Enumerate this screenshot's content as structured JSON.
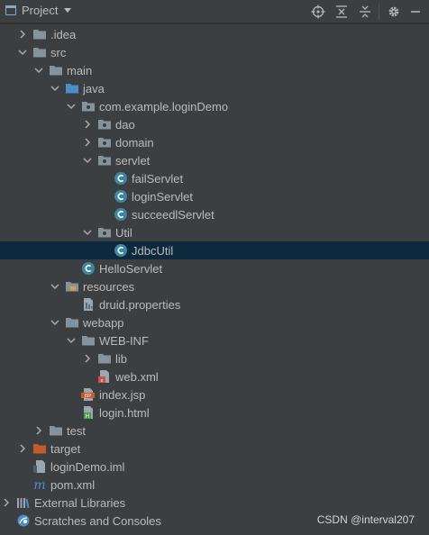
{
  "header": {
    "title": "Project",
    "icons": [
      "target-icon",
      "collapse-all-icon",
      "expand-all-icon",
      "gear-icon",
      "minimize-icon"
    ]
  },
  "colors": {
    "background": "#3c3f41",
    "selection": "#0d293e",
    "folder": "#87939a",
    "source_folder": "#4f8cc9",
    "class_icon": "#3e86a0",
    "target_folder": "#c55a2b"
  },
  "tree": [
    {
      "label": ".idea",
      "icon": "folder-icon",
      "arrow": "collapsed"
    },
    {
      "label": "src",
      "icon": "folder-icon",
      "arrow": "expanded"
    },
    {
      "label": "main",
      "icon": "folder-icon",
      "arrow": "expanded"
    },
    {
      "label": "java",
      "icon": "source-folder-icon",
      "arrow": "expanded"
    },
    {
      "label": "com.example.loginDemo",
      "icon": "package-icon",
      "arrow": "expanded"
    },
    {
      "label": "dao",
      "icon": "package-icon",
      "arrow": "collapsed"
    },
    {
      "label": "domain",
      "icon": "package-icon",
      "arrow": "collapsed"
    },
    {
      "label": "servlet",
      "icon": "package-icon",
      "arrow": "expanded"
    },
    {
      "label": "failServlet",
      "icon": "class-icon",
      "arrow": "none"
    },
    {
      "label": "loginServlet",
      "icon": "class-icon",
      "arrow": "none"
    },
    {
      "label": "succeedlServlet",
      "icon": "class-icon",
      "arrow": "none"
    },
    {
      "label": "Util",
      "icon": "package-icon",
      "arrow": "expanded"
    },
    {
      "label": "JdbcUtil",
      "icon": "class-icon",
      "arrow": "none",
      "selected": true
    },
    {
      "label": "HelloServlet",
      "icon": "class-icon",
      "arrow": "none"
    },
    {
      "label": "resources",
      "icon": "resources-folder-icon",
      "arrow": "expanded"
    },
    {
      "label": "druid.properties",
      "icon": "properties-file-icon",
      "arrow": "none"
    },
    {
      "label": "webapp",
      "icon": "web-folder-icon",
      "arrow": "expanded"
    },
    {
      "label": "WEB-INF",
      "icon": "folder-icon",
      "arrow": "expanded"
    },
    {
      "label": "lib",
      "icon": "folder-icon",
      "arrow": "collapsed"
    },
    {
      "label": "web.xml",
      "icon": "xml-file-icon",
      "arrow": "none"
    },
    {
      "label": "index.jsp",
      "icon": "jsp-file-icon",
      "arrow": "none"
    },
    {
      "label": "login.html",
      "icon": "html-file-icon",
      "arrow": "none"
    },
    {
      "label": "test",
      "icon": "folder-icon",
      "arrow": "collapsed"
    },
    {
      "label": "target",
      "icon": "target-folder-icon",
      "arrow": "collapsed"
    },
    {
      "label": "loginDemo.iml",
      "icon": "iml-file-icon",
      "arrow": "none"
    },
    {
      "label": "pom.xml",
      "icon": "maven-icon",
      "arrow": "none"
    },
    {
      "label": "External Libraries",
      "icon": "libraries-icon",
      "arrow": "collapsed"
    },
    {
      "label": "Scratches and Consoles",
      "icon": "scratches-icon",
      "arrow": "none"
    }
  ],
  "watermark": "CSDN @interval207"
}
